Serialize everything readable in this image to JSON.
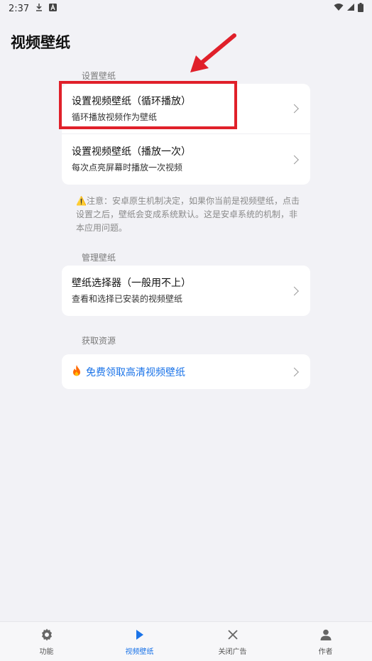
{
  "status_bar": {
    "time": "2:37",
    "icons": [
      "download-icon",
      "a-notification-icon",
      "wifi-icon",
      "signal-icon",
      "battery-icon"
    ]
  },
  "page": {
    "title": "视频壁纸"
  },
  "sections": {
    "set_wallpaper": {
      "label": "设置壁纸",
      "items": [
        {
          "title": "设置视频壁纸（循环播放）",
          "subtitle": "循环播放视频作为壁纸"
        },
        {
          "title": "设置视频壁纸（播放一次）",
          "subtitle": "每次点亮屏幕时播放一次视频"
        }
      ]
    },
    "notice": "⚠️注意：安卓原生机制决定，如果你当前是视频壁纸，点击设置之后，壁纸会变成系统默认。这是安卓系统的机制，非本应用问题。",
    "manage": {
      "label": "管理壁纸",
      "items": [
        {
          "title": "壁纸选择器（一般用不上）",
          "subtitle": "查看和选择已安装的视频壁纸"
        }
      ]
    },
    "resources": {
      "label": "获取资源",
      "items": [
        {
          "title": "免费领取高清视频壁纸",
          "icon": "fire-icon"
        }
      ]
    }
  },
  "bottom_nav": {
    "items": [
      {
        "label": "功能",
        "icon": "gear-icon",
        "active": false
      },
      {
        "label": "视频壁纸",
        "icon": "play-icon",
        "active": true
      },
      {
        "label": "关闭广告",
        "icon": "close-icon",
        "active": false
      },
      {
        "label": "作者",
        "icon": "person-icon",
        "active": false
      }
    ]
  },
  "colors": {
    "accent": "#1a73e8",
    "highlight": "#e0202a",
    "background": "#f2f2f6"
  }
}
